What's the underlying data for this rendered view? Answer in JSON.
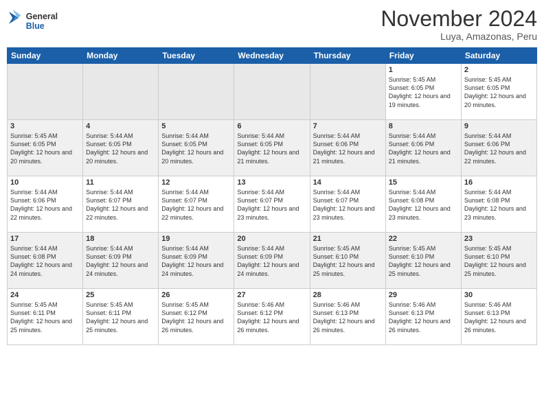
{
  "header": {
    "logo": {
      "general": "General",
      "blue": "Blue"
    },
    "title": "November 2024",
    "location": "Luya, Amazonas, Peru"
  },
  "weekdays": [
    "Sunday",
    "Monday",
    "Tuesday",
    "Wednesday",
    "Thursday",
    "Friday",
    "Saturday"
  ],
  "weeks": [
    {
      "days": [
        {
          "num": "",
          "info": ""
        },
        {
          "num": "",
          "info": ""
        },
        {
          "num": "",
          "info": ""
        },
        {
          "num": "",
          "info": ""
        },
        {
          "num": "",
          "info": ""
        },
        {
          "num": "1",
          "info": "Sunrise: 5:45 AM\nSunset: 6:05 PM\nDaylight: 12 hours and 19 minutes."
        },
        {
          "num": "2",
          "info": "Sunrise: 5:45 AM\nSunset: 6:05 PM\nDaylight: 12 hours and 20 minutes."
        }
      ]
    },
    {
      "days": [
        {
          "num": "3",
          "info": "Sunrise: 5:45 AM\nSunset: 6:05 PM\nDaylight: 12 hours and 20 minutes."
        },
        {
          "num": "4",
          "info": "Sunrise: 5:44 AM\nSunset: 6:05 PM\nDaylight: 12 hours and 20 minutes."
        },
        {
          "num": "5",
          "info": "Sunrise: 5:44 AM\nSunset: 6:05 PM\nDaylight: 12 hours and 20 minutes."
        },
        {
          "num": "6",
          "info": "Sunrise: 5:44 AM\nSunset: 6:05 PM\nDaylight: 12 hours and 21 minutes."
        },
        {
          "num": "7",
          "info": "Sunrise: 5:44 AM\nSunset: 6:06 PM\nDaylight: 12 hours and 21 minutes."
        },
        {
          "num": "8",
          "info": "Sunrise: 5:44 AM\nSunset: 6:06 PM\nDaylight: 12 hours and 21 minutes."
        },
        {
          "num": "9",
          "info": "Sunrise: 5:44 AM\nSunset: 6:06 PM\nDaylight: 12 hours and 22 minutes."
        }
      ]
    },
    {
      "days": [
        {
          "num": "10",
          "info": "Sunrise: 5:44 AM\nSunset: 6:06 PM\nDaylight: 12 hours and 22 minutes."
        },
        {
          "num": "11",
          "info": "Sunrise: 5:44 AM\nSunset: 6:07 PM\nDaylight: 12 hours and 22 minutes."
        },
        {
          "num": "12",
          "info": "Sunrise: 5:44 AM\nSunset: 6:07 PM\nDaylight: 12 hours and 22 minutes."
        },
        {
          "num": "13",
          "info": "Sunrise: 5:44 AM\nSunset: 6:07 PM\nDaylight: 12 hours and 23 minutes."
        },
        {
          "num": "14",
          "info": "Sunrise: 5:44 AM\nSunset: 6:07 PM\nDaylight: 12 hours and 23 minutes."
        },
        {
          "num": "15",
          "info": "Sunrise: 5:44 AM\nSunset: 6:08 PM\nDaylight: 12 hours and 23 minutes."
        },
        {
          "num": "16",
          "info": "Sunrise: 5:44 AM\nSunset: 6:08 PM\nDaylight: 12 hours and 23 minutes."
        }
      ]
    },
    {
      "days": [
        {
          "num": "17",
          "info": "Sunrise: 5:44 AM\nSunset: 6:08 PM\nDaylight: 12 hours and 24 minutes."
        },
        {
          "num": "18",
          "info": "Sunrise: 5:44 AM\nSunset: 6:09 PM\nDaylight: 12 hours and 24 minutes."
        },
        {
          "num": "19",
          "info": "Sunrise: 5:44 AM\nSunset: 6:09 PM\nDaylight: 12 hours and 24 minutes."
        },
        {
          "num": "20",
          "info": "Sunrise: 5:44 AM\nSunset: 6:09 PM\nDaylight: 12 hours and 24 minutes."
        },
        {
          "num": "21",
          "info": "Sunrise: 5:45 AM\nSunset: 6:10 PM\nDaylight: 12 hours and 25 minutes."
        },
        {
          "num": "22",
          "info": "Sunrise: 5:45 AM\nSunset: 6:10 PM\nDaylight: 12 hours and 25 minutes."
        },
        {
          "num": "23",
          "info": "Sunrise: 5:45 AM\nSunset: 6:10 PM\nDaylight: 12 hours and 25 minutes."
        }
      ]
    },
    {
      "days": [
        {
          "num": "24",
          "info": "Sunrise: 5:45 AM\nSunset: 6:11 PM\nDaylight: 12 hours and 25 minutes."
        },
        {
          "num": "25",
          "info": "Sunrise: 5:45 AM\nSunset: 6:11 PM\nDaylight: 12 hours and 25 minutes."
        },
        {
          "num": "26",
          "info": "Sunrise: 5:45 AM\nSunset: 6:12 PM\nDaylight: 12 hours and 26 minutes."
        },
        {
          "num": "27",
          "info": "Sunrise: 5:46 AM\nSunset: 6:12 PM\nDaylight: 12 hours and 26 minutes."
        },
        {
          "num": "28",
          "info": "Sunrise: 5:46 AM\nSunset: 6:13 PM\nDaylight: 12 hours and 26 minutes."
        },
        {
          "num": "29",
          "info": "Sunrise: 5:46 AM\nSunset: 6:13 PM\nDaylight: 12 hours and 26 minutes."
        },
        {
          "num": "30",
          "info": "Sunrise: 5:46 AM\nSunset: 6:13 PM\nDaylight: 12 hours and 26 minutes."
        }
      ]
    }
  ],
  "colors": {
    "header_bg": "#1a5fa8",
    "header_text": "#ffffff",
    "odd_row": "#ffffff",
    "even_row": "#f0f0f0",
    "empty_cell": "#e0e0e0"
  }
}
